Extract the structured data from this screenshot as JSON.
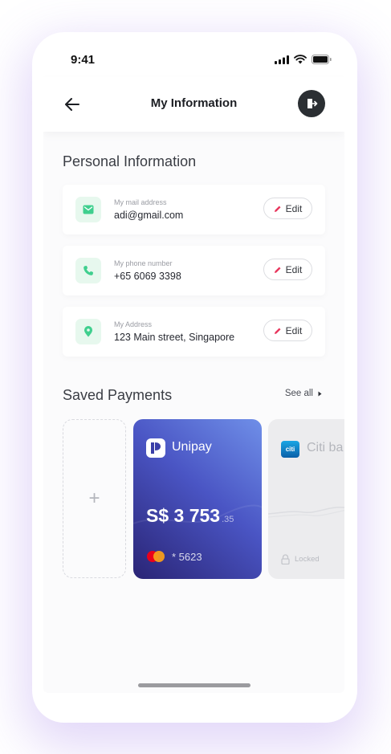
{
  "status_bar": {
    "time": "9:41"
  },
  "header": {
    "title": "My Information"
  },
  "personal": {
    "heading": "Personal Information",
    "items": [
      {
        "label": "My mail address",
        "value": "adi@gmail.com",
        "icon": "mail-icon",
        "edit": "Edit"
      },
      {
        "label": "My phone number",
        "value": "+65 6069 3398",
        "icon": "phone-icon",
        "edit": "Edit"
      },
      {
        "label": "My Address",
        "value": "123 Main street, Singapore",
        "icon": "location-icon",
        "edit": "Edit"
      }
    ]
  },
  "payments": {
    "heading": "Saved Payments",
    "see_all": "See all",
    "add_label": "+",
    "cards": [
      {
        "name": "Unipay",
        "currency": "S$",
        "amount": "3 753",
        "cents": ".35",
        "masked": "* 5623"
      },
      {
        "name": "Citi ba",
        "locked": "Locked"
      }
    ]
  },
  "colors": {
    "accent_green": "#3fcf8e",
    "icon_bg": "#e7f8ee",
    "edit_pencil": "#e8365d",
    "card_gradient_start": "#2a2475",
    "card_gradient_end": "#6f8fe8"
  }
}
